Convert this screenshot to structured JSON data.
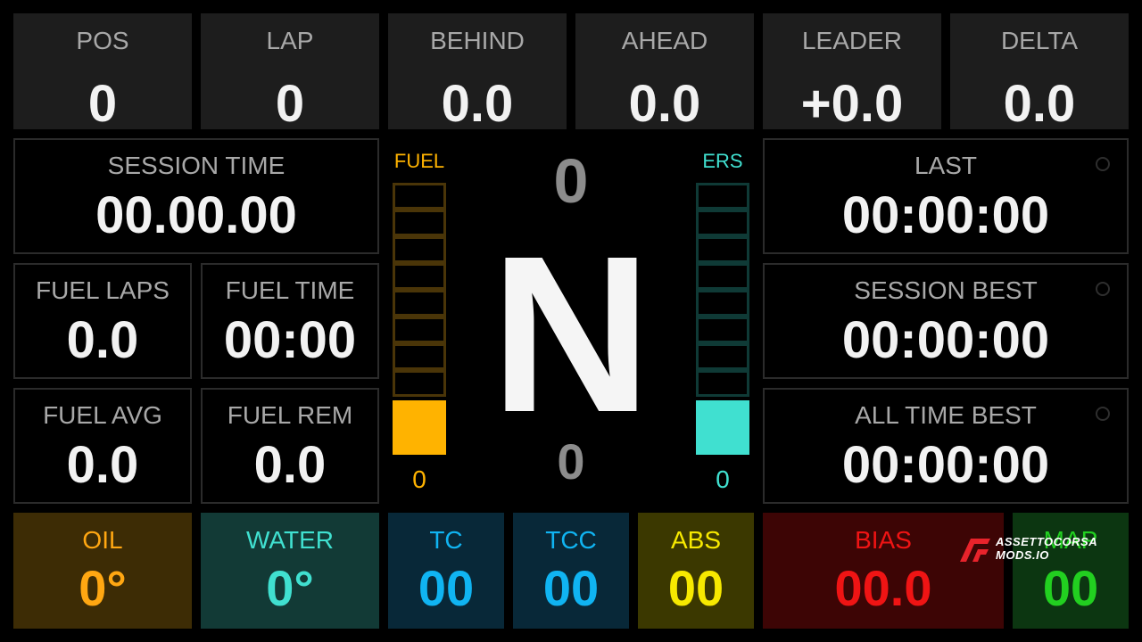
{
  "top": [
    {
      "name": "pos",
      "label": "POS",
      "value": "0"
    },
    {
      "name": "lap",
      "label": "LAP",
      "value": "0"
    },
    {
      "name": "behind",
      "label": "BEHIND",
      "value": "0.0"
    },
    {
      "name": "ahead",
      "label": "AHEAD",
      "value": "0.0"
    },
    {
      "name": "leader",
      "label": "LEADER",
      "value": "+0.0"
    },
    {
      "name": "delta",
      "label": "DELTA",
      "value": "0.0"
    }
  ],
  "left": {
    "session_time": {
      "label": "SESSION TIME",
      "value": "00.00.00"
    },
    "fuel_laps": {
      "label": "FUEL LAPS",
      "value": "0.0"
    },
    "fuel_time": {
      "label": "FUEL TIME",
      "value": "00:00"
    },
    "fuel_avg": {
      "label": "FUEL AVG",
      "value": "0.0"
    },
    "fuel_rem": {
      "label": "FUEL REM",
      "value": "0.0"
    }
  },
  "right": {
    "last": {
      "label": "LAST",
      "value": "00:00:00"
    },
    "session_best": {
      "label": "SESSION BEST",
      "value": "00:00:00"
    },
    "all_time_best": {
      "label": "ALL TIME BEST",
      "value": "00:00:00"
    }
  },
  "center": {
    "gear": "N",
    "speed": "0",
    "rpm": "0",
    "fuel": {
      "label": "FUEL",
      "value": "0",
      "level": 0.2,
      "color": "#ffb300"
    },
    "ers": {
      "label": "ERS",
      "value": "0",
      "level": 0.2,
      "color": "#40e0d0"
    }
  },
  "bottom": [
    {
      "name": "oil",
      "label": "OIL",
      "value": "0°",
      "bg": "#3d2c05",
      "color": "#ffa712"
    },
    {
      "name": "water",
      "label": "WATER",
      "value": "0°",
      "bg": "#123a36",
      "color": "#40e0d0"
    },
    {
      "name": "tc",
      "label": "TC",
      "value": "00",
      "bg": "#082838",
      "color": "#10b4f2"
    },
    {
      "name": "tcc",
      "label": "TCC",
      "value": "00",
      "bg": "#082838",
      "color": "#10b4f2"
    },
    {
      "name": "abs",
      "label": "ABS",
      "value": "00",
      "bg": "#3b3800",
      "color": "#f7e900"
    },
    {
      "name": "bias",
      "label": "BIAS",
      "value": "00.0",
      "bg": "#3d0505",
      "color": "#ef1414"
    },
    {
      "name": "map",
      "label": "MAP",
      "value": "00",
      "bg": "#0c3611",
      "color": "#22cf20"
    }
  ],
  "watermark": {
    "line1": "ASSETTOCORSA",
    "line2": "MODS.IO"
  }
}
